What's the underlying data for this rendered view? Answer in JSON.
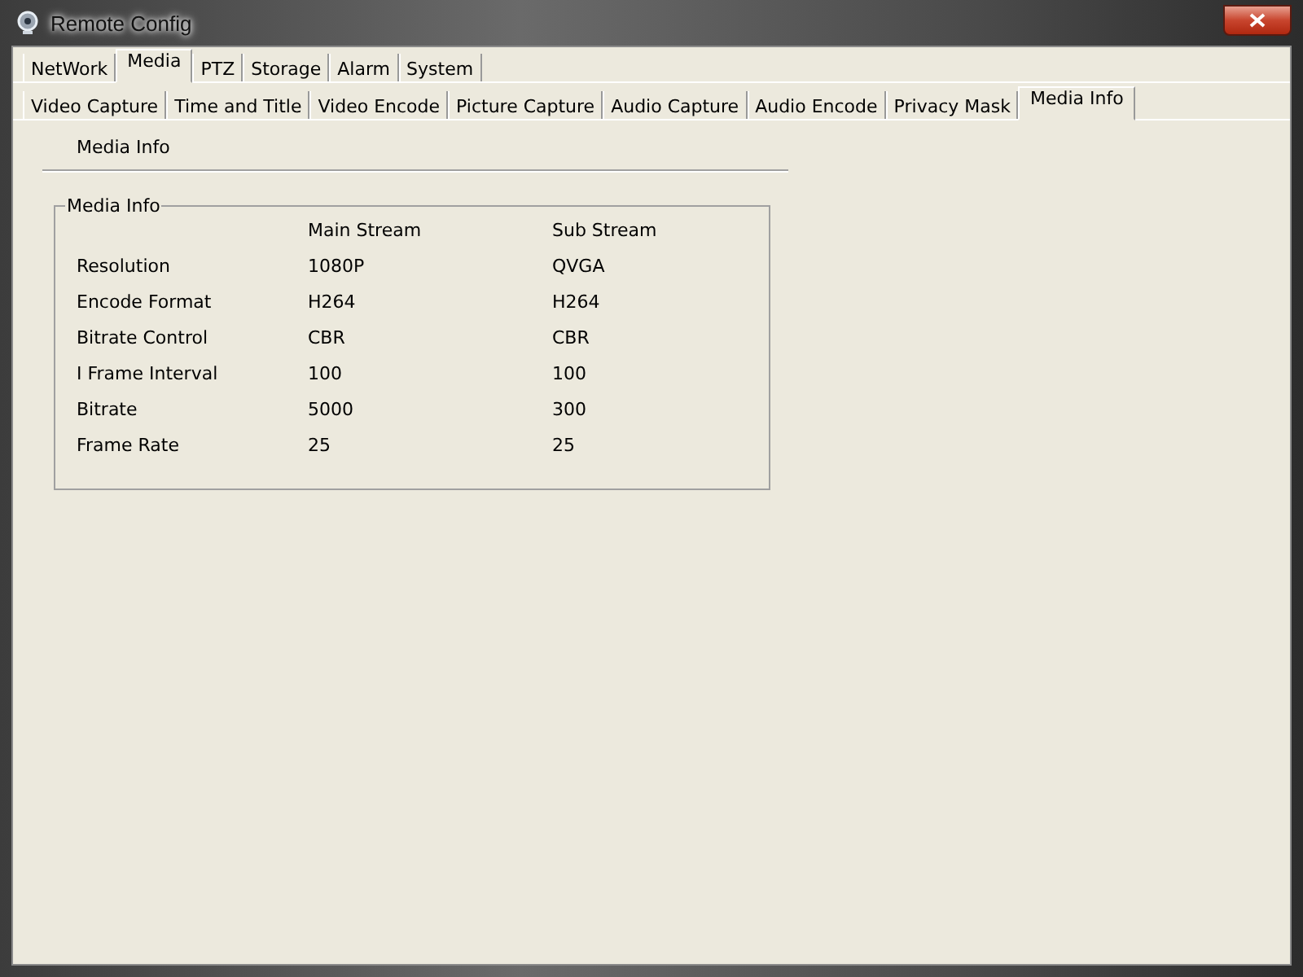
{
  "window": {
    "title": "Remote Config"
  },
  "tabs": [
    {
      "label": "NetWork",
      "selected": false
    },
    {
      "label": "Media",
      "selected": true
    },
    {
      "label": "PTZ",
      "selected": false
    },
    {
      "label": "Storage",
      "selected": false
    },
    {
      "label": "Alarm",
      "selected": false
    },
    {
      "label": "System",
      "selected": false
    }
  ],
  "sub_tabs": [
    {
      "label": "Video Capture",
      "selected": false
    },
    {
      "label": "Time and Title",
      "selected": false
    },
    {
      "label": "Video Encode",
      "selected": false
    },
    {
      "label": "Picture Capture",
      "selected": false
    },
    {
      "label": "Audio Capture",
      "selected": false
    },
    {
      "label": "Audio Encode",
      "selected": false
    },
    {
      "label": "Privacy Mask",
      "selected": false
    },
    {
      "label": "Media Info",
      "selected": true
    }
  ],
  "section_title": "Media Info",
  "group": {
    "title": "Media Info",
    "columns": [
      "Main Stream",
      "Sub Stream"
    ],
    "rows": [
      {
        "label": "Resolution",
        "main": "1080P",
        "sub": "QVGA"
      },
      {
        "label": "Encode Format",
        "main": "H264",
        "sub": "H264"
      },
      {
        "label": "Bitrate Control",
        "main": "CBR",
        "sub": "CBR"
      },
      {
        "label": "I Frame Interval",
        "main": "100",
        "sub": "100"
      },
      {
        "label": "Bitrate",
        "main": "5000",
        "sub": "300"
      },
      {
        "label": "Frame Rate",
        "main": "25",
        "sub": "25"
      }
    ]
  }
}
